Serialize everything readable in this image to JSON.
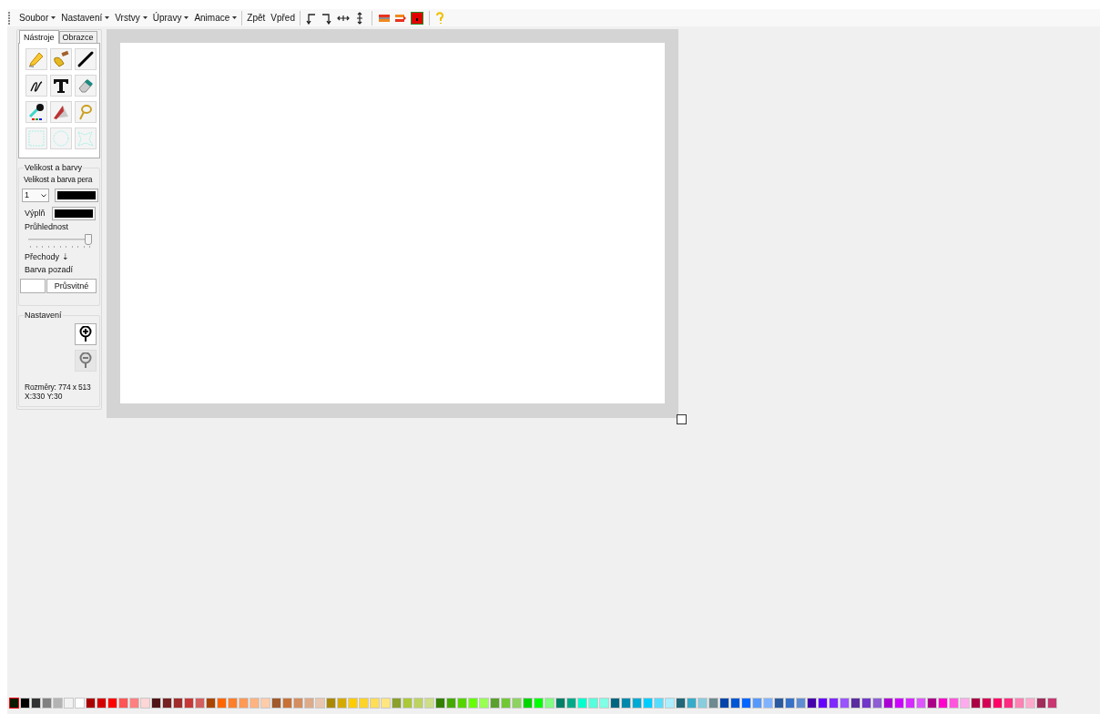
{
  "menu": [
    {
      "label": "Soubor",
      "dropdown": true
    },
    {
      "label": "Nastavení",
      "dropdown": true
    },
    {
      "label": "Vrstvy",
      "dropdown": true
    },
    {
      "label": "Úpravy",
      "dropdown": true
    },
    {
      "label": "Animace",
      "dropdown": true
    },
    {
      "label": "Zpět",
      "dropdown": false
    },
    {
      "label": "Vpřed",
      "dropdown": false
    }
  ],
  "toolbar_icons": [
    {
      "kind": "rotate-left"
    },
    {
      "kind": "rotate-right"
    },
    {
      "kind": "flip-horizontal"
    },
    {
      "kind": "flip-vertical"
    },
    {
      "kind": "sep"
    },
    {
      "kind": "layer-left"
    },
    {
      "kind": "layer-right"
    },
    {
      "kind": "layer-fill"
    },
    {
      "kind": "sep"
    },
    {
      "kind": "help"
    }
  ],
  "tabs": [
    {
      "label": "Nástroje",
      "selected": true
    },
    {
      "label": "Obrazce",
      "selected": false
    }
  ],
  "tools": [
    {
      "kind": "pencil"
    },
    {
      "kind": "brush"
    },
    {
      "kind": "line"
    },
    {
      "kind": "pen"
    },
    {
      "kind": "text"
    },
    {
      "kind": "eraser"
    },
    {
      "kind": "dropper"
    },
    {
      "kind": "fill"
    },
    {
      "kind": "lasso"
    },
    {
      "kind": "select-rect"
    },
    {
      "kind": "select-ellipse"
    },
    {
      "kind": "select-free"
    }
  ],
  "size_group": {
    "title": "Velikost a barvy",
    "pen_label": "Velikost a barva pera",
    "pen_size": "1",
    "pen_swatch": {
      "color": "#000000"
    },
    "fill_label": "Výplň",
    "fill_swatch": {
      "color": "#000000"
    },
    "opacity_label": "Průhlednost",
    "opacity": {
      "level": 0.94
    },
    "gradients": "Přechody ⇣",
    "background_label": "Barva pozadí",
    "background_swatch": {
      "color": "#ffffff"
    },
    "transparent_button": "Průsvitné"
  },
  "settings_group": {
    "title": "Nastavení",
    "zoom_buttons": [
      {
        "kind": "zoom-in",
        "disabled": false
      },
      {
        "kind": "zoom-out",
        "disabled": true
      }
    ],
    "dimensions": "Rozměry: 774 x 513",
    "position": "X:330 Y:30"
  },
  "palette": [
    {
      "color": "#0a1a00",
      "selected": true
    },
    {
      "color": "#000000",
      "selected": false
    },
    {
      "color": "#333333",
      "selected": false
    },
    {
      "color": "#808080",
      "selected": false
    },
    {
      "color": "#b3b3b3",
      "selected": false
    },
    {
      "color": "#f2f2f2",
      "selected": false
    },
    {
      "color": "#ffffff",
      "selected": false
    },
    {
      "color": "#aa0000",
      "selected": false
    },
    {
      "color": "#d40000",
      "selected": false
    },
    {
      "color": "#ff0000",
      "selected": false
    },
    {
      "color": "#ff5555",
      "selected": false
    },
    {
      "color": "#ff8080",
      "selected": false
    },
    {
      "color": "#ffd5d5",
      "selected": false
    },
    {
      "color": "#501616",
      "selected": false
    },
    {
      "color": "#782121",
      "selected": false
    },
    {
      "color": "#a02c2c",
      "selected": false
    },
    {
      "color": "#c83737",
      "selected": false
    },
    {
      "color": "#d35f5f",
      "selected": false
    },
    {
      "color": "#aa4400",
      "selected": false
    },
    {
      "color": "#ff6600",
      "selected": false
    },
    {
      "color": "#ff7f2a",
      "selected": false
    },
    {
      "color": "#ff9955",
      "selected": false
    },
    {
      "color": "#ffb380",
      "selected": false
    },
    {
      "color": "#ffccaa",
      "selected": false
    },
    {
      "color": "#a05a2c",
      "selected": false
    },
    {
      "color": "#c87137",
      "selected": false
    },
    {
      "color": "#d38d5f",
      "selected": false
    },
    {
      "color": "#deaa87",
      "selected": false
    },
    {
      "color": "#e9c6af",
      "selected": false
    },
    {
      "color": "#aa8800",
      "selected": false
    },
    {
      "color": "#d4aa00",
      "selected": false
    },
    {
      "color": "#ffcc00",
      "selected": false
    },
    {
      "color": "#ffd42a",
      "selected": false
    },
    {
      "color": "#ffdd55",
      "selected": false
    },
    {
      "color": "#ffe680",
      "selected": false
    },
    {
      "color": "#89a02c",
      "selected": false
    },
    {
      "color": "#abc837",
      "selected": false
    },
    {
      "color": "#bcd35f",
      "selected": false
    },
    {
      "color": "#cdde87",
      "selected": false
    },
    {
      "color": "#338000",
      "selected": false
    },
    {
      "color": "#44aa00",
      "selected": false
    },
    {
      "color": "#55d400",
      "selected": false
    },
    {
      "color": "#66ff00",
      "selected": false
    },
    {
      "color": "#99ff55",
      "selected": false
    },
    {
      "color": "#5aa02c",
      "selected": false
    },
    {
      "color": "#71c837",
      "selected": false
    },
    {
      "color": "#8dd35f",
      "selected": false
    },
    {
      "color": "#00d400",
      "selected": false
    },
    {
      "color": "#00ff00",
      "selected": false
    },
    {
      "color": "#80ff80",
      "selected": false
    },
    {
      "color": "#008066",
      "selected": false
    },
    {
      "color": "#00aa88",
      "selected": false
    },
    {
      "color": "#00ffcc",
      "selected": false
    },
    {
      "color": "#55ffdd",
      "selected": false
    },
    {
      "color": "#80ffe6",
      "selected": false
    },
    {
      "color": "#006680",
      "selected": false
    },
    {
      "color": "#0088aa",
      "selected": false
    },
    {
      "color": "#00aad4",
      "selected": false
    },
    {
      "color": "#00ccff",
      "selected": false
    },
    {
      "color": "#55ddff",
      "selected": false
    },
    {
      "color": "#aaeeff",
      "selected": false
    },
    {
      "color": "#216778",
      "selected": false
    },
    {
      "color": "#37abc8",
      "selected": false
    },
    {
      "color": "#87cdde",
      "selected": false
    },
    {
      "color": "#6c8a8f",
      "selected": false
    },
    {
      "color": "#0044aa",
      "selected": false
    },
    {
      "color": "#0055d4",
      "selected": false
    },
    {
      "color": "#0066ff",
      "selected": false
    },
    {
      "color": "#5599ff",
      "selected": false
    },
    {
      "color": "#80b3ff",
      "selected": false
    },
    {
      "color": "#2c5aa0",
      "selected": false
    },
    {
      "color": "#3771c8",
      "selected": false
    },
    {
      "color": "#5f8dd3",
      "selected": false
    },
    {
      "color": "#4400aa",
      "selected": false
    },
    {
      "color": "#6600ff",
      "selected": false
    },
    {
      "color": "#7f2aff",
      "selected": false
    },
    {
      "color": "#9955ff",
      "selected": false
    },
    {
      "color": "#5a2ca0",
      "selected": false
    },
    {
      "color": "#7137c8",
      "selected": false
    },
    {
      "color": "#8d5fd3",
      "selected": false
    },
    {
      "color": "#aa00d4",
      "selected": false
    },
    {
      "color": "#cc00ff",
      "selected": false
    },
    {
      "color": "#d42aff",
      "selected": false
    },
    {
      "color": "#dd55ff",
      "selected": false
    },
    {
      "color": "#aa0088",
      "selected": false
    },
    {
      "color": "#ff00cc",
      "selected": false
    },
    {
      "color": "#ff55dd",
      "selected": false
    },
    {
      "color": "#ffaaee",
      "selected": false
    },
    {
      "color": "#aa0044",
      "selected": false
    },
    {
      "color": "#d40055",
      "selected": false
    },
    {
      "color": "#ff0066",
      "selected": false
    },
    {
      "color": "#ff2a7f",
      "selected": false
    },
    {
      "color": "#ff80b2",
      "selected": false
    },
    {
      "color": "#ffaacc",
      "selected": false
    },
    {
      "color": "#a02c5a",
      "selected": false
    },
    {
      "color": "#c83771",
      "selected": false
    }
  ]
}
